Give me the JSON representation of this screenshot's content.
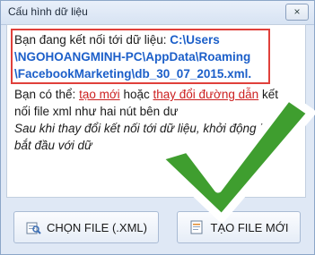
{
  "window": {
    "title": "Cấu hình dữ liệu",
    "close_label": "×"
  },
  "message": {
    "line1_prefix": "Bạn đang kết nối tới dữ liệu: ",
    "line1_path": "C:\\Users",
    "line2_path": "\\NGOHOANGMINH-PC\\AppData\\Roaming",
    "line3_path": "\\FacebookMarketing\\db_30_07_2015.xml.",
    "line4_prefix": "Bạn có thể: ",
    "link_new": "tạo mới",
    "line4_mid": " hoặc ",
    "link_change": "thay đổi đường dẫn",
    "line4_suffix": " kết",
    "line5": "nối file xml như hai nút bên dư",
    "line6": "Sau khi thay đổi kết nối tới dữ liệu, khởi động lại để",
    "line7": "bắt đầu với dữ"
  },
  "buttons": {
    "choose_file": "CHỌN FILE (.XML)",
    "new_file": "TẠO FILE MỚI"
  },
  "colors": {
    "path": "#1c5fc9",
    "link": "#cc1f1f",
    "highlight_border": "#e0403b",
    "checkmark": "#3f9e2f"
  },
  "icons": {
    "choose_file": "file-browse-icon",
    "new_file": "new-file-icon",
    "overlay": "checkmark-icon"
  }
}
